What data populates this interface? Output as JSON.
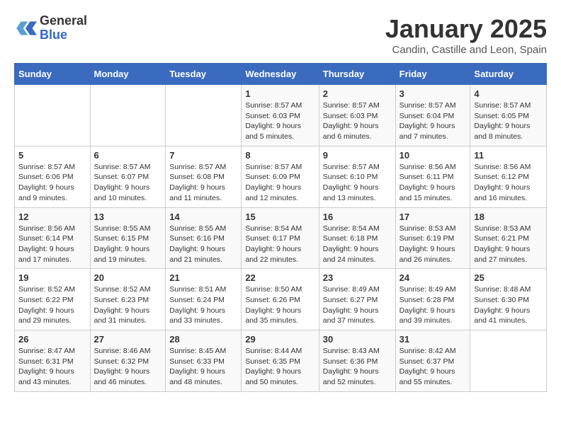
{
  "header": {
    "logo_general": "General",
    "logo_blue": "Blue",
    "month_title": "January 2025",
    "subtitle": "Candin, Castille and Leon, Spain"
  },
  "weekdays": [
    "Sunday",
    "Monday",
    "Tuesday",
    "Wednesday",
    "Thursday",
    "Friday",
    "Saturday"
  ],
  "weeks": [
    [
      {
        "day": "",
        "info": ""
      },
      {
        "day": "",
        "info": ""
      },
      {
        "day": "",
        "info": ""
      },
      {
        "day": "1",
        "info": "Sunrise: 8:57 AM\nSunset: 6:03 PM\nDaylight: 9 hours and 5 minutes."
      },
      {
        "day": "2",
        "info": "Sunrise: 8:57 AM\nSunset: 6:03 PM\nDaylight: 9 hours and 6 minutes."
      },
      {
        "day": "3",
        "info": "Sunrise: 8:57 AM\nSunset: 6:04 PM\nDaylight: 9 hours and 7 minutes."
      },
      {
        "day": "4",
        "info": "Sunrise: 8:57 AM\nSunset: 6:05 PM\nDaylight: 9 hours and 8 minutes."
      }
    ],
    [
      {
        "day": "5",
        "info": "Sunrise: 8:57 AM\nSunset: 6:06 PM\nDaylight: 9 hours and 9 minutes."
      },
      {
        "day": "6",
        "info": "Sunrise: 8:57 AM\nSunset: 6:07 PM\nDaylight: 9 hours and 10 minutes."
      },
      {
        "day": "7",
        "info": "Sunrise: 8:57 AM\nSunset: 6:08 PM\nDaylight: 9 hours and 11 minutes."
      },
      {
        "day": "8",
        "info": "Sunrise: 8:57 AM\nSunset: 6:09 PM\nDaylight: 9 hours and 12 minutes."
      },
      {
        "day": "9",
        "info": "Sunrise: 8:57 AM\nSunset: 6:10 PM\nDaylight: 9 hours and 13 minutes."
      },
      {
        "day": "10",
        "info": "Sunrise: 8:56 AM\nSunset: 6:11 PM\nDaylight: 9 hours and 15 minutes."
      },
      {
        "day": "11",
        "info": "Sunrise: 8:56 AM\nSunset: 6:12 PM\nDaylight: 9 hours and 16 minutes."
      }
    ],
    [
      {
        "day": "12",
        "info": "Sunrise: 8:56 AM\nSunset: 6:14 PM\nDaylight: 9 hours and 17 minutes."
      },
      {
        "day": "13",
        "info": "Sunrise: 8:55 AM\nSunset: 6:15 PM\nDaylight: 9 hours and 19 minutes."
      },
      {
        "day": "14",
        "info": "Sunrise: 8:55 AM\nSunset: 6:16 PM\nDaylight: 9 hours and 21 minutes."
      },
      {
        "day": "15",
        "info": "Sunrise: 8:54 AM\nSunset: 6:17 PM\nDaylight: 9 hours and 22 minutes."
      },
      {
        "day": "16",
        "info": "Sunrise: 8:54 AM\nSunset: 6:18 PM\nDaylight: 9 hours and 24 minutes."
      },
      {
        "day": "17",
        "info": "Sunrise: 8:53 AM\nSunset: 6:19 PM\nDaylight: 9 hours and 26 minutes."
      },
      {
        "day": "18",
        "info": "Sunrise: 8:53 AM\nSunset: 6:21 PM\nDaylight: 9 hours and 27 minutes."
      }
    ],
    [
      {
        "day": "19",
        "info": "Sunrise: 8:52 AM\nSunset: 6:22 PM\nDaylight: 9 hours and 29 minutes."
      },
      {
        "day": "20",
        "info": "Sunrise: 8:52 AM\nSunset: 6:23 PM\nDaylight: 9 hours and 31 minutes."
      },
      {
        "day": "21",
        "info": "Sunrise: 8:51 AM\nSunset: 6:24 PM\nDaylight: 9 hours and 33 minutes."
      },
      {
        "day": "22",
        "info": "Sunrise: 8:50 AM\nSunset: 6:26 PM\nDaylight: 9 hours and 35 minutes."
      },
      {
        "day": "23",
        "info": "Sunrise: 8:49 AM\nSunset: 6:27 PM\nDaylight: 9 hours and 37 minutes."
      },
      {
        "day": "24",
        "info": "Sunrise: 8:49 AM\nSunset: 6:28 PM\nDaylight: 9 hours and 39 minutes."
      },
      {
        "day": "25",
        "info": "Sunrise: 8:48 AM\nSunset: 6:30 PM\nDaylight: 9 hours and 41 minutes."
      }
    ],
    [
      {
        "day": "26",
        "info": "Sunrise: 8:47 AM\nSunset: 6:31 PM\nDaylight: 9 hours and 43 minutes."
      },
      {
        "day": "27",
        "info": "Sunrise: 8:46 AM\nSunset: 6:32 PM\nDaylight: 9 hours and 46 minutes."
      },
      {
        "day": "28",
        "info": "Sunrise: 8:45 AM\nSunset: 6:33 PM\nDaylight: 9 hours and 48 minutes."
      },
      {
        "day": "29",
        "info": "Sunrise: 8:44 AM\nSunset: 6:35 PM\nDaylight: 9 hours and 50 minutes."
      },
      {
        "day": "30",
        "info": "Sunrise: 8:43 AM\nSunset: 6:36 PM\nDaylight: 9 hours and 52 minutes."
      },
      {
        "day": "31",
        "info": "Sunrise: 8:42 AM\nSunset: 6:37 PM\nDaylight: 9 hours and 55 minutes."
      },
      {
        "day": "",
        "info": ""
      }
    ]
  ]
}
